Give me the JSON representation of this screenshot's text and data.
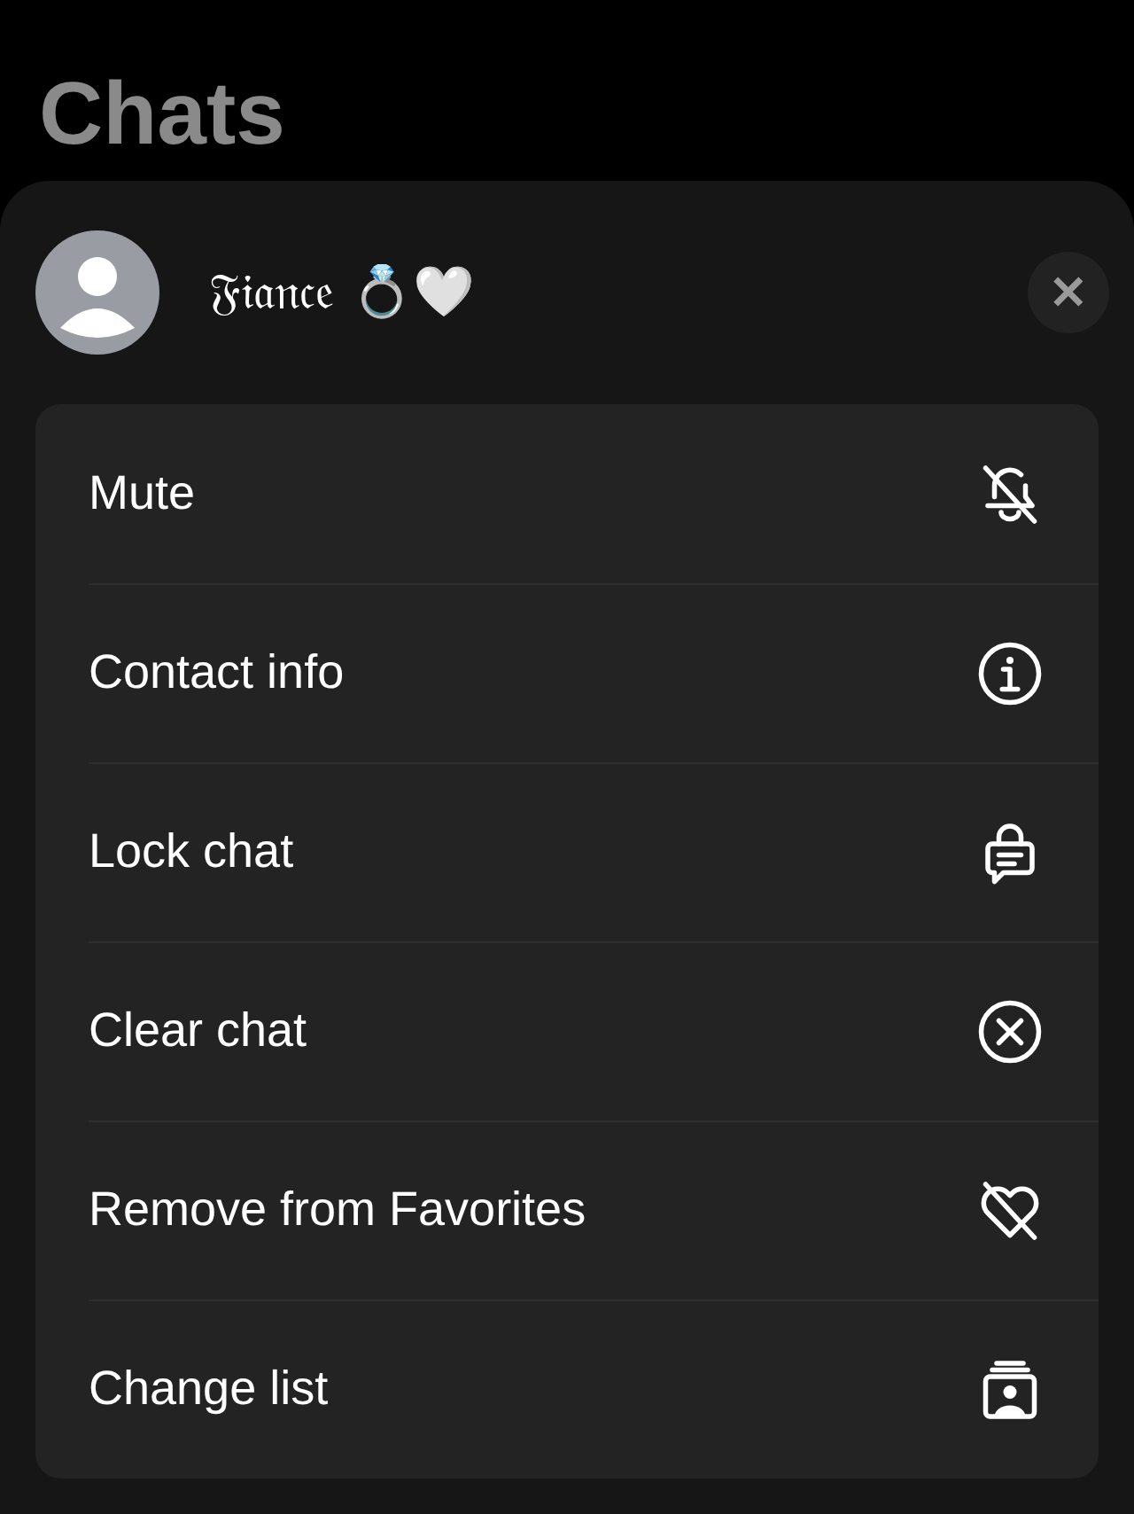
{
  "header": {
    "title": "Chats"
  },
  "contact": {
    "name": "𝔉𝔦𝔞𝔫𝔠𝔢 💍🤍",
    "close": "✕"
  },
  "menu": [
    {
      "label": "Mute",
      "kind": "bell-off"
    },
    {
      "label": "Contact info",
      "kind": "info"
    },
    {
      "label": "Lock chat",
      "kind": "lock-chat"
    },
    {
      "label": "Clear chat",
      "kind": "clear"
    },
    {
      "label": "Remove from Favorites",
      "kind": "heart-off"
    },
    {
      "label": "Change list",
      "kind": "list"
    }
  ]
}
